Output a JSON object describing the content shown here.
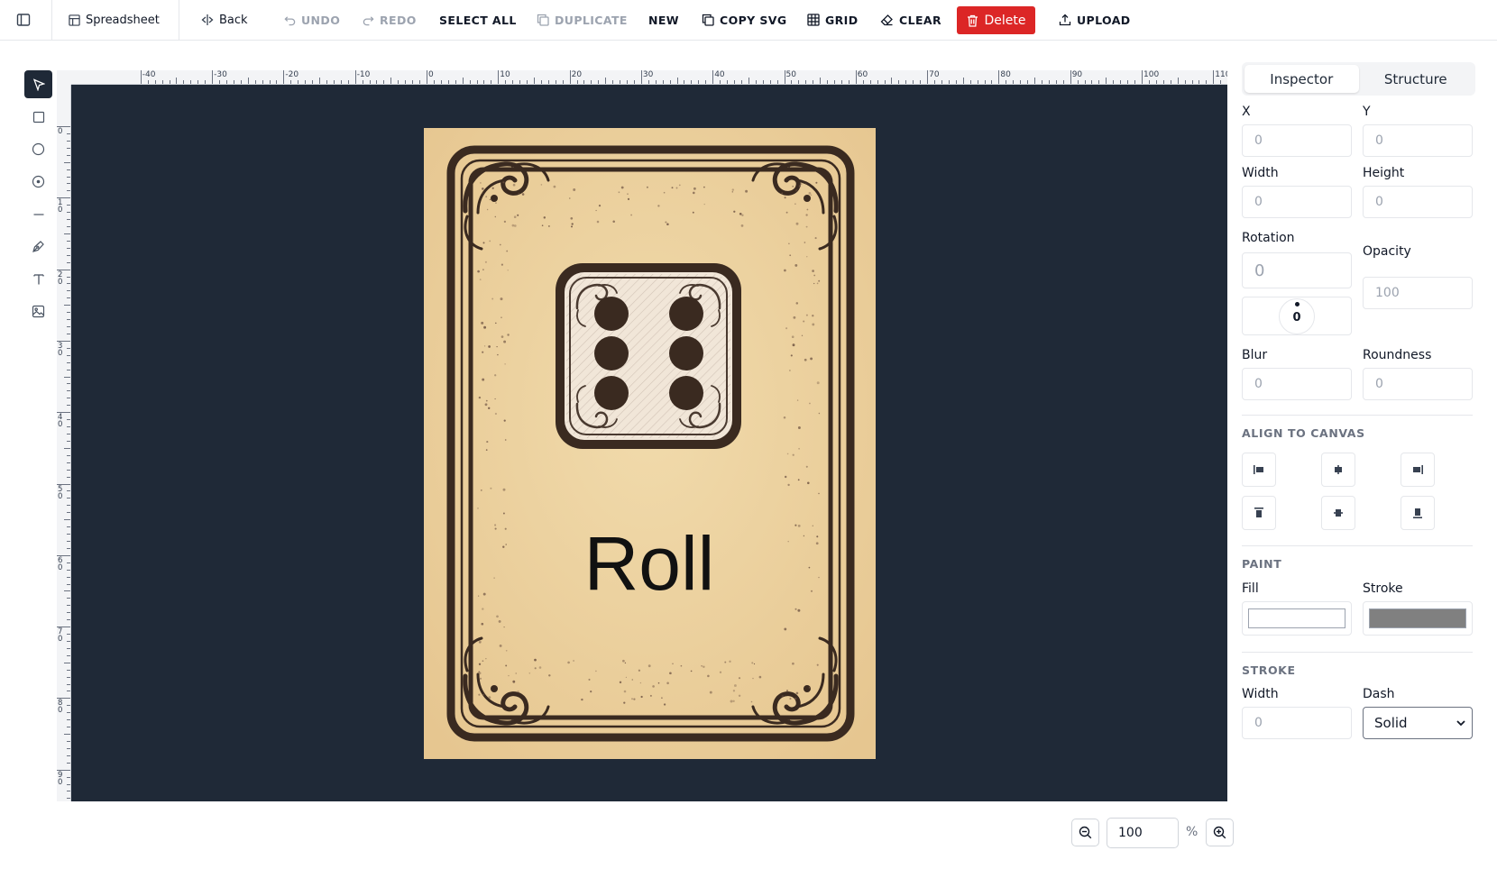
{
  "toolbar": {
    "spreadsheet": "Spreadsheet",
    "back": "Back",
    "undo": "UNDO",
    "redo": "REDO",
    "select_all": "SELECT ALL",
    "duplicate": "DUPLICATE",
    "new": "NEW",
    "copy_svg": "COPY SVG",
    "grid": "GRID",
    "clear": "CLEAR",
    "delete": "Delete",
    "upload": "UPLOAD"
  },
  "tools": [
    "pointer-icon",
    "rectangle-icon",
    "ellipse-icon",
    "target-icon",
    "line-icon",
    "pen-icon",
    "text-icon",
    "image-icon"
  ],
  "ruler": {
    "h_labels": [
      "-40",
      "-30",
      "-20",
      "-10",
      "0",
      "10",
      "20",
      "30",
      "40",
      "50",
      "60",
      "70",
      "80",
      "90",
      "100",
      "110"
    ],
    "v_labels": [
      "0",
      "10",
      "20",
      "30",
      "40",
      "50",
      "60",
      "70",
      "80",
      "90"
    ]
  },
  "card": {
    "text": "Roll",
    "die_value": 6
  },
  "zoom": {
    "value": "100",
    "unit": "%"
  },
  "inspector": {
    "tabs": [
      "Inspector",
      "Structure"
    ],
    "x_label": "X",
    "x": "0",
    "y_label": "Y",
    "y": "0",
    "width_label": "Width",
    "width": "0",
    "height_label": "Height",
    "height": "0",
    "rotation_label": "Rotation",
    "rotation": "0",
    "rotation_dial": "0",
    "opacity_label": "Opacity",
    "opacity": "100",
    "blur_label": "Blur",
    "blur": "0",
    "roundness_label": "Roundness",
    "roundness": "0",
    "align_title": "ALIGN TO CANVAS",
    "paint_title": "PAINT",
    "fill_label": "Fill",
    "fill_color": "#ffffff",
    "stroke_label": "Stroke",
    "stroke_color": "#808080",
    "stroke_title": "STROKE",
    "stroke_width_label": "Width",
    "stroke_width": "0",
    "dash_label": "Dash",
    "dash": "Solid"
  },
  "colors": {
    "canvas_bg": "#1f2937",
    "delete_bg": "#dc2626",
    "card_bg": "#ecd3a0",
    "card_ink": "#3a2a20"
  }
}
